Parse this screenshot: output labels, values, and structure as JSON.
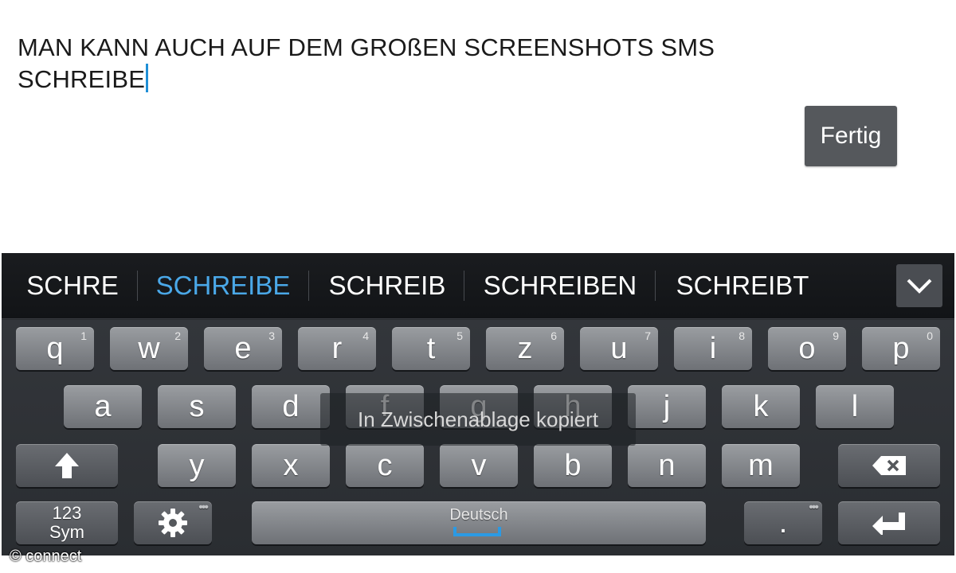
{
  "compose": {
    "text": "MAN KANN AUCH AUF DEM GROßEN SCREENSHOTS SMS SCHREIBE"
  },
  "done_button": {
    "label": "Fertig"
  },
  "suggestions": [
    "SCHRE",
    "SCHREIBE",
    "SCHREIB",
    "SCHREIBEN",
    "SCHREIBT"
  ],
  "keyboard": {
    "row1": [
      {
        "char": "q",
        "num": "1"
      },
      {
        "char": "w",
        "num": "2"
      },
      {
        "char": "e",
        "num": "3"
      },
      {
        "char": "r",
        "num": "4"
      },
      {
        "char": "t",
        "num": "5"
      },
      {
        "char": "z",
        "num": "6"
      },
      {
        "char": "u",
        "num": "7"
      },
      {
        "char": "i",
        "num": "8"
      },
      {
        "char": "o",
        "num": "9"
      },
      {
        "char": "p",
        "num": "0"
      }
    ],
    "row2": [
      "a",
      "s",
      "d",
      "f",
      "g",
      "h",
      "j",
      "k",
      "l"
    ],
    "row3": [
      "y",
      "x",
      "c",
      "v",
      "b",
      "n",
      "m"
    ],
    "sym_key": {
      "line1": "123",
      "line2": "Sym"
    },
    "space_label": "Deutsch",
    "period": "."
  },
  "toast": {
    "message": "In Zwischenablage kopiert"
  },
  "watermark": "© connect",
  "colors": {
    "accent": "#4aa8e8",
    "cursor": "#1f8fd6"
  }
}
